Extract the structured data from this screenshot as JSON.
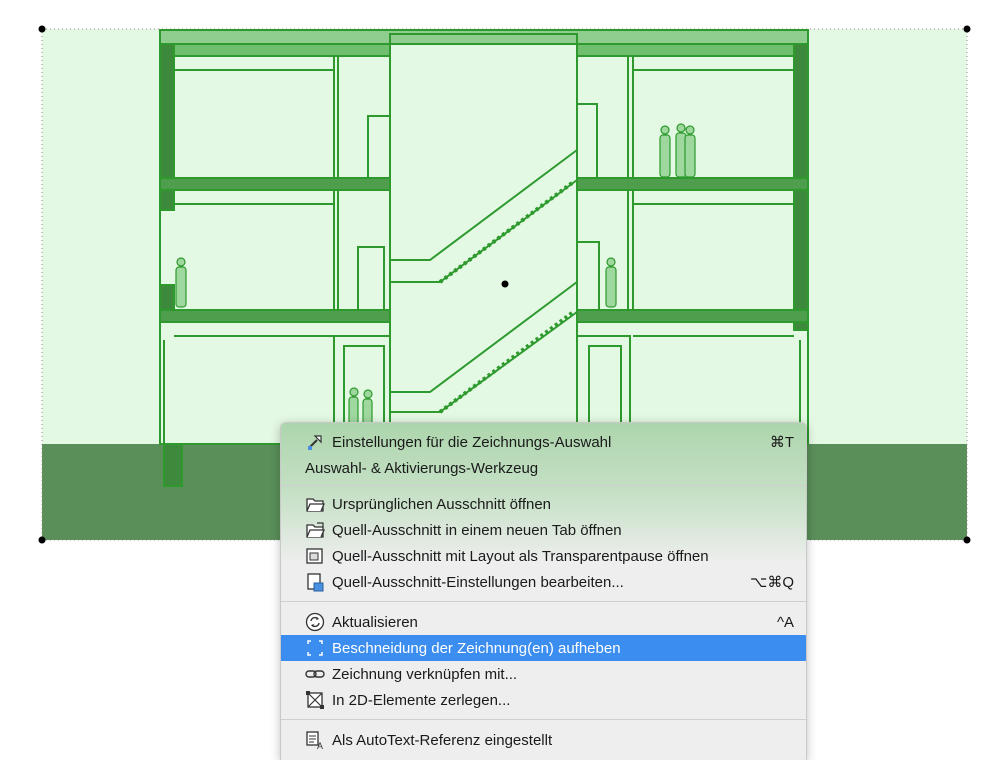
{
  "context_menu": {
    "items": [
      {
        "icon": "settings-wand-icon",
        "label": "Einstellungen für die Zeichnungs-Auswahl",
        "shortcut": "⌘T"
      },
      {
        "icon": "",
        "label": "Auswahl- & Aktivierungs-Werkzeug",
        "shortcut": ""
      },
      {
        "icon": "open-folder-icon",
        "label": "Ursprünglichen Ausschnitt öffnen",
        "shortcut": ""
      },
      {
        "icon": "open-folder-tab-icon",
        "label": "Quell-Ausschnitt in einem neuen Tab öffnen",
        "shortcut": ""
      },
      {
        "icon": "layout-trace-icon",
        "label": "Quell-Ausschnitt mit Layout als Transparentpause öffnen",
        "shortcut": ""
      },
      {
        "icon": "view-settings-icon",
        "label": "Quell-Ausschnitt-Einstellungen bearbeiten...",
        "shortcut": "⌥⌘Q"
      },
      {
        "icon": "refresh-icon",
        "label": "Aktualisieren",
        "shortcut": "^A"
      },
      {
        "icon": "crop-icon",
        "label": "Beschneidung der Zeichnung(en) aufheben",
        "shortcut": ""
      },
      {
        "icon": "link-icon",
        "label": "Zeichnung verknüpfen mit...",
        "shortcut": ""
      },
      {
        "icon": "explode-icon",
        "label": "In 2D-Elemente zerlegen...",
        "shortcut": ""
      },
      {
        "icon": "autotext-icon",
        "label": "Als AutoText-Referenz eingestellt",
        "shortcut": ""
      }
    ],
    "highlighted_index": 7
  },
  "colors": {
    "selection_fill": "#e4f9e4",
    "section_green": "#2e9a2e",
    "ground_fill": "#5a8f5a",
    "menu_highlight": "#3b8df0"
  }
}
